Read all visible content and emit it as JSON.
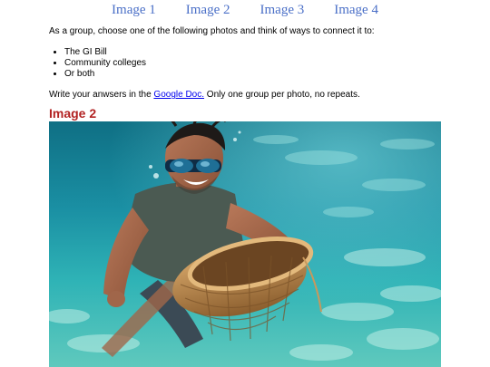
{
  "nav": {
    "tabs": [
      {
        "label": "Image 1"
      },
      {
        "label": "Image 2"
      },
      {
        "label": "Image 3"
      },
      {
        "label": "Image 4"
      }
    ]
  },
  "instructions": {
    "intro": "As a group, choose one of the following photos and think of ways to connect it to:",
    "bullets": [
      "The GI Bill",
      "Community colleges",
      "Or both"
    ],
    "write_prefix": "Write your anwsers in the ",
    "doc_link": "Google Doc.",
    "write_suffix": " Only one group per photo, no repeats."
  },
  "section": {
    "title": "Image 2"
  },
  "colors": {
    "tab_link": "#4a6fc7",
    "heading": "#b22222",
    "link": "#0000ee"
  }
}
